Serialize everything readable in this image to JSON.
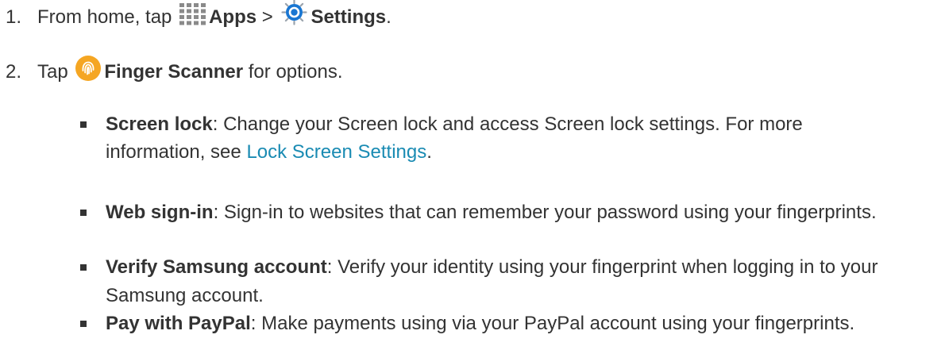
{
  "step1": {
    "number": "1.",
    "prefix": "From home, tap",
    "apps_icon": "apps-grid-icon",
    "apps_label": "Apps",
    "separator": ">",
    "settings_icon": "settings-gear-icon",
    "settings_label": "Settings",
    "suffix": "."
  },
  "step2": {
    "number": "2.",
    "prefix": "Tap",
    "finger_icon": "fingerprint-icon",
    "finger_label": "Finger Scanner",
    "suffix": "for options."
  },
  "bullets": [
    {
      "title": "Screen lock",
      "text_line1": ": Change your Screen lock and access Screen lock settings. For more",
      "text_line2_prefix": "information, see",
      "link_text": "Lock Screen Settings",
      "text_line2_suffix": "."
    },
    {
      "title": "Web sign-in",
      "text": ": Sign-in to websites that can remember your password using your fingerprints."
    },
    {
      "title": "Verify Samsung account",
      "text_line1": ": Verify your identity using your fingerprint when logging in to your",
      "text_line2": "Samsung account."
    },
    {
      "title": "Pay with PayPal",
      "text": ": Make payments using via your PayPal account using your fingerprints."
    }
  ],
  "colors": {
    "text": "#333333",
    "link": "#1a8bb3",
    "fingerprint_icon": "#f5a623",
    "settings_icon": "#1976d2"
  }
}
